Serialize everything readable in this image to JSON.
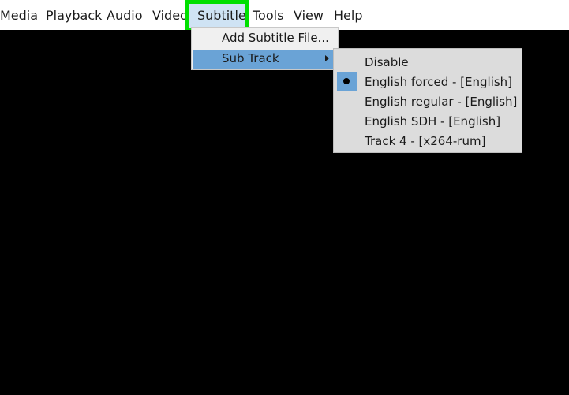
{
  "menubar": {
    "items": [
      "Media",
      "Playback",
      "Audio",
      "Video",
      "Subtitle",
      "Tools",
      "View",
      "Help"
    ]
  },
  "subtitle_menu": {
    "items": [
      {
        "label": "Add Subtitle File...",
        "has_submenu": false,
        "highlighted": false
      },
      {
        "label": "Sub Track",
        "has_submenu": true,
        "highlighted": true
      }
    ]
  },
  "sub_track_menu": {
    "items": [
      {
        "label": "Disable",
        "selected": false
      },
      {
        "label": "English forced - [English]",
        "selected": true
      },
      {
        "label": "English regular - [English]",
        "selected": false
      },
      {
        "label": "English SDH - [English]",
        "selected": false
      },
      {
        "label": "Track 4 - [x264-rum]",
        "selected": false
      }
    ]
  },
  "colors": {
    "highlight_border": "#00e000",
    "menu_selection": "#6aa3d6",
    "video_background": "#000000"
  }
}
